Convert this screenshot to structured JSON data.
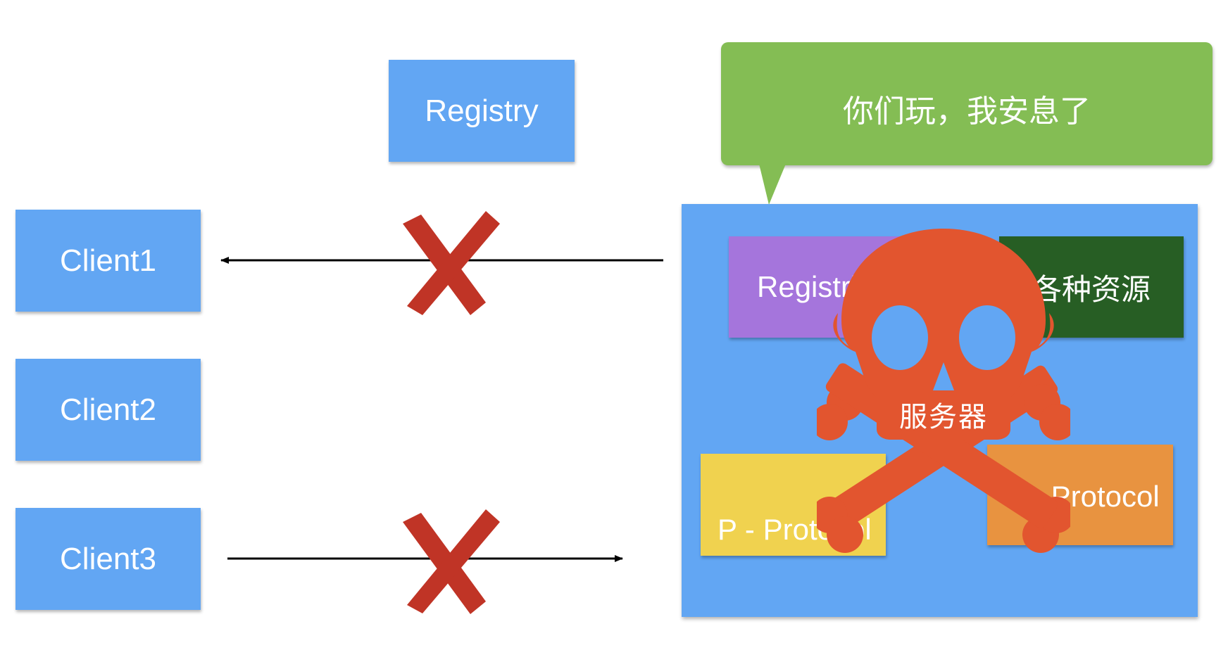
{
  "registry": {
    "label": "Registry"
  },
  "clients": [
    {
      "label": "Client1"
    },
    {
      "label": "Client2"
    },
    {
      "label": "Client3"
    }
  ],
  "speech_bubble": {
    "text": "你们玩，我安息了"
  },
  "server": {
    "registries_label": "Registri",
    "resources_label": "各种资源",
    "p_protocol_label": "P - Protocol",
    "c_protocol_label": "C - Protocol",
    "skull_teeth_label": "服务器"
  },
  "colors": {
    "node_blue": "#62a6f3",
    "bubble_green": "#84bd54",
    "registries_purple": "#a575dc",
    "resources_green": "#275e24",
    "p_protocol_yellow": "#f0d24f",
    "c_protocol_orange": "#e89340",
    "skull_red": "#e2552f",
    "cross_red": "#c03426"
  },
  "icons": {
    "cross_mark": "x-mark-icon",
    "skull": "skull-crossbones-icon"
  }
}
